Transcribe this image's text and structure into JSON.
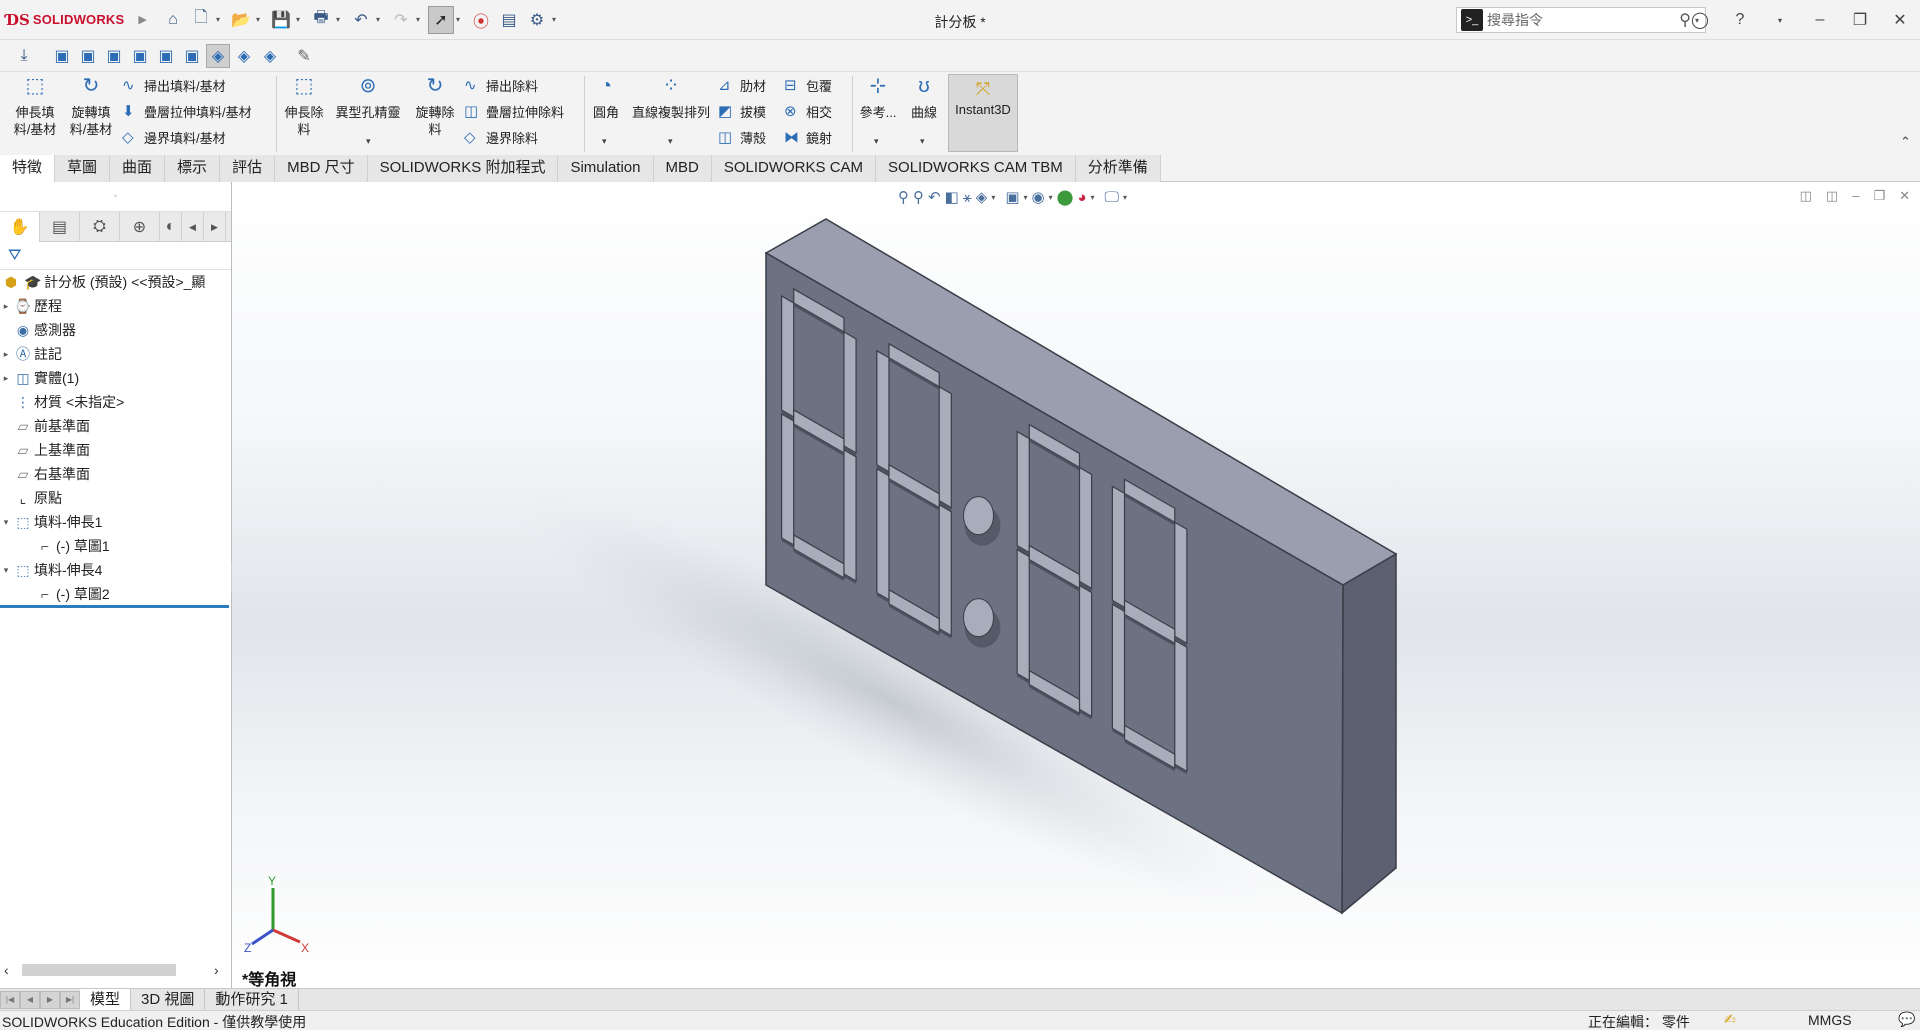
{
  "app": {
    "brand": "SOLIDWORKS",
    "document_title": "計分板 *"
  },
  "search": {
    "placeholder": "搜尋指令"
  },
  "ribbon": {
    "extrude_boss": "伸長填\n料/基材",
    "revolve_boss": "旋轉填\n料/基材",
    "swept_boss": "掃出填料/基材",
    "lofted_boss": "疊層拉伸填料/基材",
    "boundary_boss": "邊界填料/基材",
    "extrude_cut": "伸長除\n料",
    "hole_wizard": "異型孔精靈",
    "revolve_cut": "旋轉除\n料",
    "swept_cut": "掃出除料",
    "lofted_cut": "疊層拉伸除料",
    "boundary_cut": "邊界除料",
    "fillet": "圓角",
    "linear_pattern": "直線複製排列",
    "rib": "肋材",
    "wrap": "包覆",
    "draft": "拔模",
    "intersect": "相交",
    "shell": "薄殼",
    "mirror": "鏡射",
    "reference": "參考...",
    "curves": "曲線",
    "instant3d": "Instant3D"
  },
  "tabs": [
    "特徵",
    "草圖",
    "曲面",
    "標示",
    "評估",
    "MBD 尺寸",
    "SOLIDWORKS 附加程式",
    "Simulation",
    "MBD",
    "SOLIDWORKS CAM",
    "SOLIDWORKS CAM TBM",
    "分析準備"
  ],
  "tree": {
    "root": "計分板 (預設) <<預設>_顯",
    "items": [
      "歷程",
      "感測器",
      "註記",
      "實體(1)",
      "材質 <未指定>",
      "前基準面",
      "上基準面",
      "右基準面",
      "原點",
      "填料-伸長1",
      "(-) 草圖1",
      "填料-伸長4",
      "(-) 草圖2"
    ]
  },
  "viewport": {
    "view_name": "*等角視",
    "axis_x": "X",
    "axis_y": "Y",
    "axis_z": "Z"
  },
  "bottom_tabs": [
    "模型",
    "3D 視圖",
    "動作研究 1"
  ],
  "status": {
    "left": "SOLIDWORKS Education Edition - 僅供教學使用",
    "editing": "正在編輯： 零件",
    "units": "MMGS"
  },
  "colors": {
    "model_front": "#6d7282",
    "model_side": "#5c6070",
    "model_top": "#9a9eae",
    "accent": "#c8102e"
  }
}
